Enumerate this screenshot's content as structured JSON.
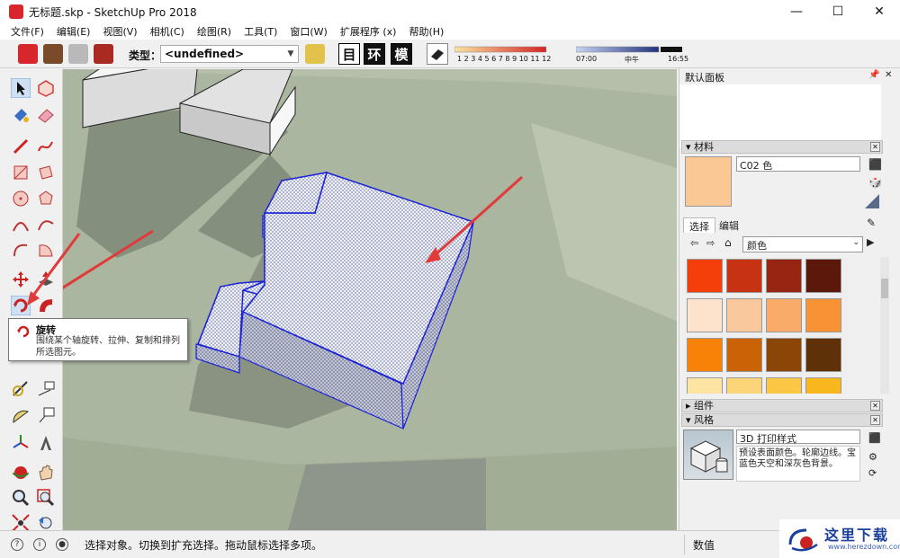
{
  "window": {
    "title": "无标题.skp - SketchUp Pro 2018",
    "minimize": "—",
    "maximize": "☐",
    "close": "✕"
  },
  "menu": [
    "文件(F)",
    "编辑(E)",
    "视图(V)",
    "相机(C)",
    "绘图(R)",
    "工具(T)",
    "窗口(W)",
    "扩展程序 (x)",
    "帮助(H)"
  ],
  "toolbar": {
    "type_label": "类型：",
    "type_value": "<undefined>",
    "btn_1": "目",
    "btn_2": "环",
    "btn_3": "模",
    "month_scale": "1 2 3 4 5 6 7 8 9 10 11 12",
    "time_start": "07:00",
    "time_mid": "中午",
    "time_end": "16:55"
  },
  "tooltip": {
    "title": "旋转",
    "description": "围绕某个轴旋转、拉伸、复制和排列所选图元。"
  },
  "status": {
    "message": "选择对象。切换到扩充选择。拖动鼠标选择多项。",
    "value_label": "数值"
  },
  "panel": {
    "title": "默认面板",
    "pin": "📌",
    "close": "✕",
    "materials": {
      "header": "材料",
      "material_name": "C02 色",
      "material_color": "#f9c895",
      "tab_select": "选择",
      "tab_edit": "编辑",
      "category": "颜色",
      "swatches": [
        "#f53f0b",
        "#c73213",
        "#962611",
        "#5d180c",
        "#fde3cc",
        "#fbc79c",
        "#f9ab6a",
        "#f89335",
        "#f88107",
        "#c96305",
        "#8b4506",
        "#5e3109",
        "#fde4a3",
        "#fcd578",
        "#fbc744",
        "#f9b71e"
      ]
    },
    "components": {
      "header": "组件"
    },
    "styles": {
      "header": "风格",
      "style_name": "3D 打印样式",
      "style_desc": "预设表面颜色。轮廓边线。宝蓝色天空和深灰色背景。"
    }
  },
  "watermark": {
    "text": "这里下载",
    "url": "www.herezdown.com"
  }
}
